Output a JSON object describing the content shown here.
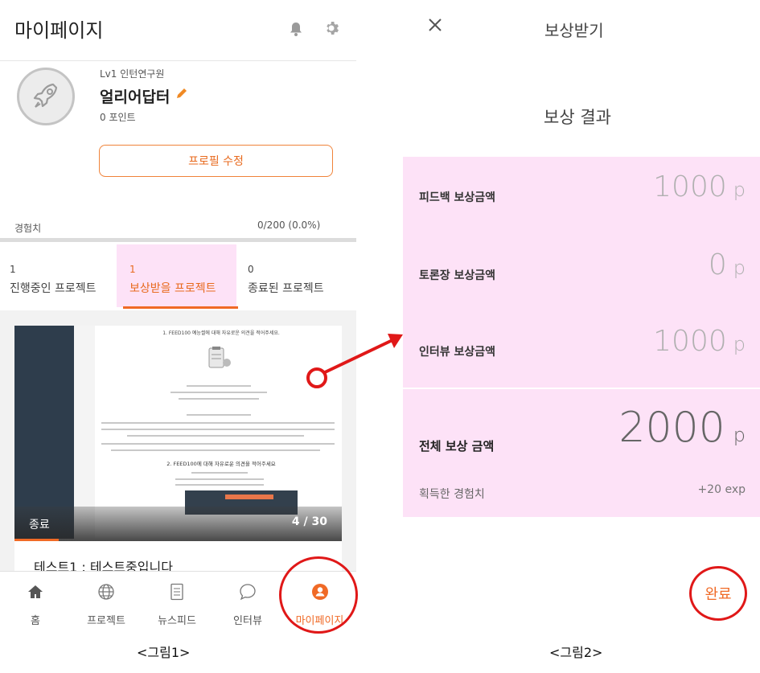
{
  "left": {
    "header_title": "마이페이지",
    "level": "Lv1 인턴연구원",
    "nickname": "얼리어답터",
    "points": "0 포인트",
    "edit_profile": "프로필 수정",
    "exp_label": "경험치",
    "exp_value": "0/200 (0.0%)",
    "exp_progress": 0,
    "tabs": [
      {
        "count": "1",
        "label": "진행중인 프로젝트",
        "active": false
      },
      {
        "count": "1",
        "label": "보상받을 프로젝트",
        "active": true
      },
      {
        "count": "0",
        "label": "종료된 프로젝트",
        "active": false
      }
    ],
    "card": {
      "doc_heading": "1. FEED100 예능썰에 대해 자유로운 의견을 적어주세요.",
      "doc_section": "2. FEED100에 대해 자유로운 의견을 적어주세요",
      "status": "종료",
      "page": "4 / 30",
      "title": "테스트1 : 테스트중입니다"
    },
    "nav": [
      {
        "label": "홈",
        "icon": "home-icon"
      },
      {
        "label": "프로젝트",
        "icon": "globe-icon"
      },
      {
        "label": "뉴스피드",
        "icon": "document-icon"
      },
      {
        "label": "인터뷰",
        "icon": "chat-bubble-icon"
      },
      {
        "label": "마이페이지",
        "icon": "user-icon",
        "active": true
      }
    ],
    "caption": "<그림1>"
  },
  "right": {
    "title": "보상받기",
    "subtitle": "보상 결과",
    "rows": [
      {
        "label": "피드백 보상금액",
        "value": "1000",
        "unit": "p"
      },
      {
        "label": "토론장 보상금액",
        "value": "0",
        "unit": "p"
      },
      {
        "label": "인터뷰 보상금액",
        "value": "1000",
        "unit": "p"
      }
    ],
    "total_label": "전체 보상 금액",
    "total_value": "2000",
    "total_unit": "p",
    "exp_label": "획득한 경험치",
    "exp_value": "+20",
    "exp_unit": "exp",
    "done": "완료",
    "caption": "<그림2>"
  },
  "colors": {
    "accent": "#f06a26",
    "highlight_pink": "#fde2f7",
    "annotation_red": "#e01818"
  }
}
